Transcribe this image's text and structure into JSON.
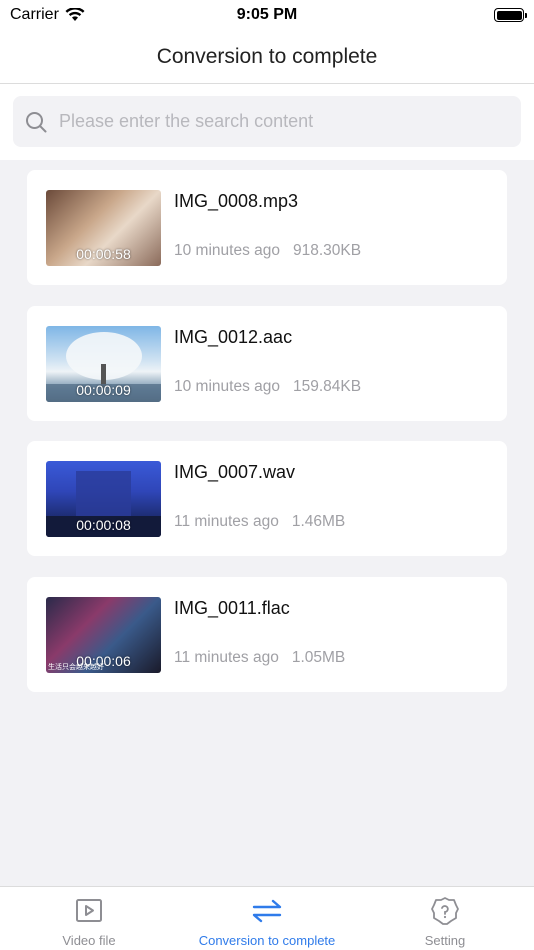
{
  "status_bar": {
    "carrier": "Carrier",
    "time": "9:05 PM"
  },
  "nav": {
    "title": "Conversion to complete"
  },
  "search": {
    "placeholder": "Please enter the search content",
    "icon": "search-icon"
  },
  "files": [
    {
      "name": "IMG_0008.mp3",
      "duration": "00:00:58",
      "time_ago": "10 minutes ago",
      "size": "918.30KB"
    },
    {
      "name": "IMG_0012.aac",
      "duration": "00:00:09",
      "time_ago": "10 minutes ago",
      "size": "159.84KB"
    },
    {
      "name": "IMG_0007.wav",
      "duration": "00:00:08",
      "time_ago": "11 minutes ago",
      "size": "1.46MB"
    },
    {
      "name": "IMG_0011.flac",
      "duration": "00:00:06",
      "time_ago": "11 minutes ago",
      "size": "1.05MB",
      "subtitle": "生活只会越来越好"
    }
  ],
  "tabs": [
    {
      "label": "Video file",
      "icon": "video-file-icon",
      "active": false
    },
    {
      "label": "Conversion to complete",
      "icon": "convert-arrows-icon",
      "active": true
    },
    {
      "label": "Setting",
      "icon": "gear-icon",
      "active": false
    }
  ],
  "colors": {
    "accent": "#2f7bea",
    "inactive": "#8e8e93",
    "background": "#f2f2f5"
  }
}
